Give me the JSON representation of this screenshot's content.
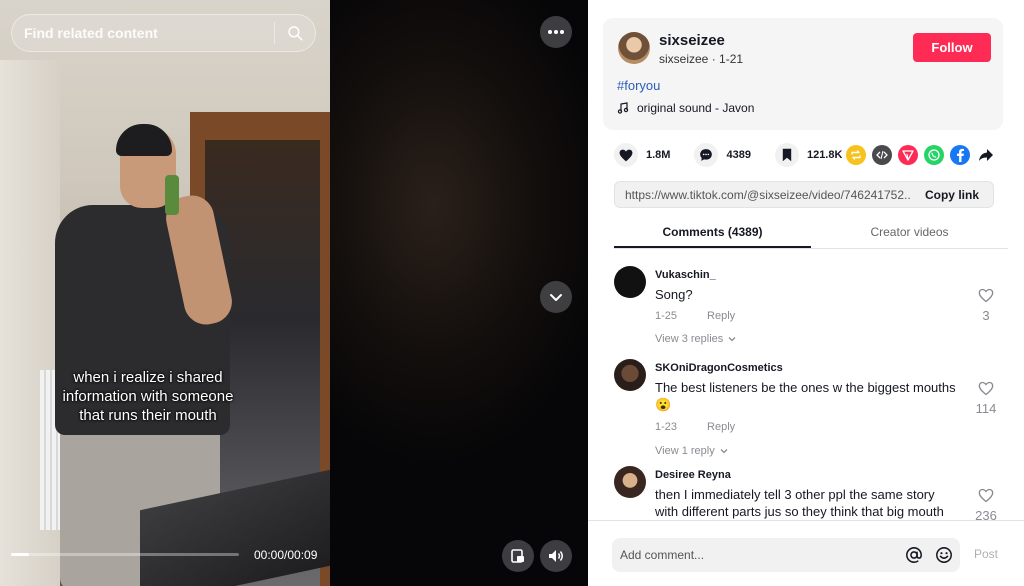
{
  "search": {
    "placeholder": "Find related content",
    "icon": "search-icon"
  },
  "video": {
    "caption_lines": [
      "when i realize i shared",
      "information with someone",
      "that runs their mouth"
    ],
    "time": "00:00/00:09",
    "progress": 0.08,
    "buttons": {
      "more": "more-icon",
      "next": "chevron-down-icon",
      "pip": "pip-icon",
      "volume": "volume-icon"
    }
  },
  "author": {
    "username": "sixseizee",
    "handle": "sixseizee",
    "date": "1-21",
    "follow_label": "Follow",
    "hashtag": "#foryou",
    "sound": "original sound - Javon"
  },
  "stats": {
    "likes": "1.8M",
    "comments": "4389",
    "saves": "121.8K"
  },
  "share": [
    "repost-icon",
    "embed-icon",
    "send-icon",
    "whatsapp-icon",
    "facebook-icon",
    "share-arrow-icon"
  ],
  "colors": {
    "follow": "#fe2c55",
    "hashtag": "#2b5db9",
    "repost": "#f7c21b",
    "embed": "#4a4a4e",
    "send": "#fe2c55",
    "whatsapp": "#25d366",
    "facebook": "#1877f2"
  },
  "link": {
    "url": "https://www.tiktok.com/@sixseizee/video/746241752...",
    "copy_label": "Copy link"
  },
  "tabs": [
    {
      "label": "Comments (4389)",
      "active": true
    },
    {
      "label": "Creator videos",
      "active": false
    }
  ],
  "comments": [
    {
      "name": "Vukaschin_",
      "text": "Song?",
      "date": "1-25",
      "reply": "Reply",
      "view_replies": "View 3 replies",
      "likes": "3"
    },
    {
      "name": "SKOniDragonCosmetics",
      "text": "The best listeners be the ones w the biggest mouths 😮",
      "date": "1-23",
      "reply": "Reply",
      "view_replies": "View 1 reply",
      "likes": "114"
    },
    {
      "name": "Desiree Reyna",
      "text": "then I immediately tell 3 other ppl the same story with different parts jus so they think that big mouth",
      "likes": "236"
    }
  ],
  "comment_bar": {
    "placeholder": "Add comment...",
    "post": "Post"
  }
}
